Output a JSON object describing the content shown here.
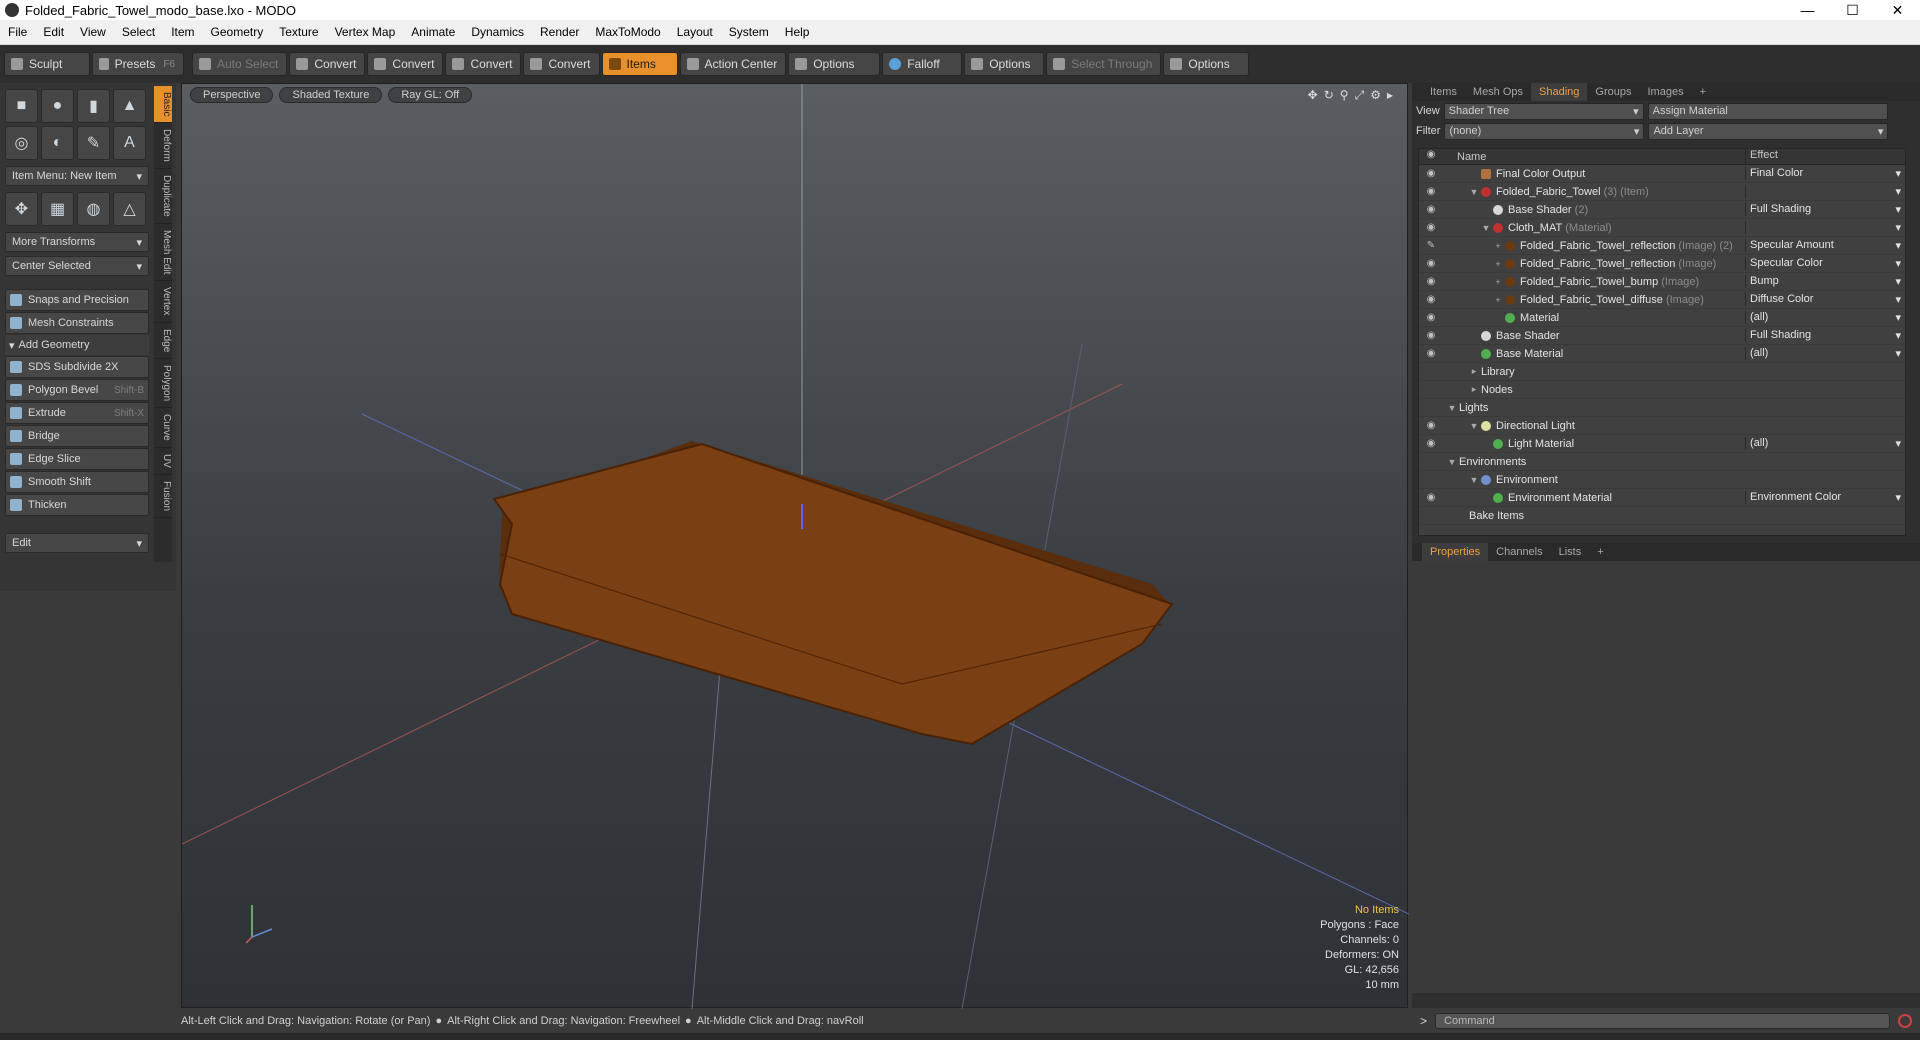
{
  "window": {
    "title": "Folded_Fabric_Towel_modo_base.lxo - MODO",
    "minimize": "—",
    "maximize": "☐",
    "close": "✕"
  },
  "menu": [
    "File",
    "Edit",
    "View",
    "Select",
    "Item",
    "Geometry",
    "Texture",
    "Vertex Map",
    "Animate",
    "Dynamics",
    "Render",
    "MaxToModo",
    "Layout",
    "System",
    "Help"
  ],
  "toolbar": {
    "sculpt": "Sculpt",
    "presets": "Presets",
    "presets_key": "F6",
    "auto_select": "Auto Select",
    "convert1": "Convert",
    "convert2": "Convert",
    "convert3": "Convert",
    "convert4": "Convert",
    "items": "Items",
    "action_center": "Action Center",
    "options1": "Options",
    "falloff": "Falloff",
    "options2": "Options",
    "select_through": "Select Through",
    "options3": "Options"
  },
  "left": {
    "item_menu": "Item Menu: New Item",
    "more_transforms": "More Transforms",
    "center_selected": "Center Selected",
    "snaps": "Snaps and Precision",
    "mesh_constraints": "Mesh Constraints",
    "add_geometry": "Add Geometry",
    "tools": [
      {
        "label": "SDS Subdivide 2X",
        "key": ""
      },
      {
        "label": "Polygon Bevel",
        "key": "Shift-B"
      },
      {
        "label": "Extrude",
        "key": "Shift-X"
      },
      {
        "label": "Bridge",
        "key": ""
      },
      {
        "label": "Edge Slice",
        "key": ""
      },
      {
        "label": "Smooth Shift",
        "key": ""
      },
      {
        "label": "Thicken",
        "key": ""
      }
    ],
    "edit": "Edit",
    "vtabs": [
      "Basic",
      "Deform",
      "Duplicate",
      "Mesh Edit",
      "Vertex",
      "Edge",
      "Polygon",
      "Curve",
      "UV",
      "Fusion"
    ]
  },
  "viewport": {
    "perspective": "Perspective",
    "shading": "Shaded Texture",
    "raygl": "Ray GL: Off",
    "info": {
      "no_items": "No Items",
      "polygons": "Polygons : Face",
      "channels": "Channels: 0",
      "deformers": "Deformers: ON",
      "gl": "GL: 42,656",
      "scale": "10 mm"
    },
    "colors": {
      "fabric": "#7a3f12",
      "fabric_edge": "#4a2208",
      "accent": "#e8912c"
    }
  },
  "right": {
    "tabs": [
      "Items",
      "Mesh Ops",
      "Shading",
      "Groups",
      "Images",
      "+"
    ],
    "view_label": "View",
    "view_value": "Shader Tree",
    "assign_material": "Assign Material",
    "filter_label": "Filter",
    "filter_value": "(none)",
    "add_layer": "Add Layer",
    "col_name": "Name",
    "col_effect": "Effect",
    "rows": [
      {
        "name": "Final Color Output",
        "suffix": "",
        "effect": "Final Color"
      },
      {
        "name": "Folded_Fabric_Towel",
        "suffix": "(3) (Item)",
        "effect": ""
      },
      {
        "name": "Base Shader",
        "suffix": "(2)",
        "effect": "Full Shading"
      },
      {
        "name": "Cloth_MAT",
        "suffix": "(Material)",
        "effect": ""
      },
      {
        "name": "Folded_Fabric_Towel_reflection",
        "suffix": "(Image) (2)",
        "effect": "Specular Amount"
      },
      {
        "name": "Folded_Fabric_Towel_reflection",
        "suffix": "(Image)",
        "effect": "Specular Color"
      },
      {
        "name": "Folded_Fabric_Towel_bump",
        "suffix": "(Image)",
        "effect": "Bump"
      },
      {
        "name": "Folded_Fabric_Towel_diffuse",
        "suffix": "(Image)",
        "effect": "Diffuse Color"
      },
      {
        "name": "Material",
        "suffix": "",
        "effect": "(all)"
      },
      {
        "name": "Base Shader",
        "suffix": "",
        "effect": "Full Shading"
      },
      {
        "name": "Base Material",
        "suffix": "",
        "effect": "(all)"
      },
      {
        "name": "Library",
        "suffix": "",
        "effect": ""
      },
      {
        "name": "Nodes",
        "suffix": "",
        "effect": ""
      },
      {
        "name": "Lights",
        "suffix": "",
        "effect": ""
      },
      {
        "name": "Directional Light",
        "suffix": "",
        "effect": ""
      },
      {
        "name": "Light Material",
        "suffix": "",
        "effect": "(all)"
      },
      {
        "name": "Environments",
        "suffix": "",
        "effect": ""
      },
      {
        "name": "Environment",
        "suffix": "",
        "effect": ""
      },
      {
        "name": "Environment Material",
        "suffix": "",
        "effect": "Environment Color"
      },
      {
        "name": "Bake Items",
        "suffix": "",
        "effect": ""
      }
    ],
    "props_tabs": [
      "Properties",
      "Channels",
      "Lists",
      "+"
    ]
  },
  "status": {
    "hint1": "Alt-Left Click and Drag: Navigation: Rotate (or Pan)",
    "hint2": "Alt-Right Click and Drag: Navigation: Freewheel",
    "hint3": "Alt-Middle Click and Drag: navRoll",
    "command_placeholder": "Command"
  }
}
